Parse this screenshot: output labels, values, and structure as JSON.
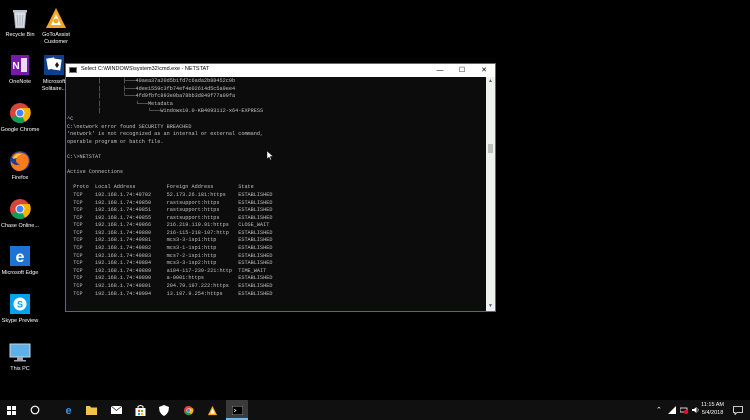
{
  "desktop": {
    "icons": [
      {
        "label": "Recycle Bin"
      },
      {
        "label": "GoToAssist Customer"
      },
      {
        "label": "OneNote"
      },
      {
        "label": "Microsoft Solitaire..."
      },
      {
        "label": "Google Chrome"
      },
      {
        "label": "Firefox"
      },
      {
        "label": "Chase Online..."
      },
      {
        "label": "Microsoft Edge"
      },
      {
        "label": "Skype Preview"
      },
      {
        "label": "This PC"
      }
    ]
  },
  "cmd_window": {
    "title": "Select C:\\WINDOWS\\system32\\cmd.exe - NETSTAT",
    "minimize_glyph": "—",
    "maximize_glyph": "☐",
    "close_glyph": "✕",
    "lines": [
      "          │       ├───40aea37a20d5b1fd7c6ada2b88452c9b",
      "          │       ├───4dee1559c3fb74ef4e02614d5c5a9ee4",
      "          │       └───4fd9fbfc893e0ba78bb3d849f77a09fa",
      "          │           └───Metadata",
      "          │               └───Windows10.0-KB4093112-x64-EXPRESS",
      "^C",
      "C:\\network error found SECURITY BREACHED",
      "'network' is not recognized as an internal or external command,",
      "operable program or batch file.",
      "",
      "C:\\>NETSTAT",
      "",
      "Active Connections",
      "",
      "  Proto  Local Address          Foreign Address        State",
      "  TCP    192.168.1.74:49702     52.173.26.181:https    ESTABLISHED",
      "  TCP    192.168.1.74:49850     rastsupport:https      ESTABLISHED",
      "  TCP    192.168.1.74:49851     rastsupport:https      ESTABLISHED",
      "  TCP    192.168.1.74:49855     rastsupport:https      ESTABLISHED",
      "  TCP    192.168.1.74:49866     216.219.119.91:https   CLOSE_WAIT",
      "  TCP    192.168.1.74:49880     216-115-218-107:http   ESTABLISHED",
      "  TCP    192.168.1.74:49881     mcs3-3-1sp1:http       ESTABLISHED",
      "  TCP    192.168.1.74:49882     mcs3-1-1sp1:http       ESTABLISHED",
      "  TCP    192.168.1.74:49883     mcs7-2-1sp1:http       ESTABLISHED",
      "  TCP    192.168.1.74:49884     mcs3-3-1sp2:http       ESTABLISHED",
      "  TCP    192.168.1.74:49889     a104-117-239-221:http  TIME_WAIT",
      "  TCP    192.168.1.74:49890     a-0001:https           ESTABLISHED",
      "  TCP    192.168.1.74:49891     204.79.197.222:https   ESTABLISHED",
      "  TCP    192.168.1.74:49904     13.107.9.254:https     ESTABLISHED"
    ]
  },
  "taskbar": {
    "time": "11:15 AM",
    "date": "5/4/2018"
  },
  "colors": {
    "accent": "#2b6fd1",
    "terminal_bg": "#0c0c0c",
    "terminal_text": "#c0c0c0",
    "taskbar_bg": "#101010"
  }
}
